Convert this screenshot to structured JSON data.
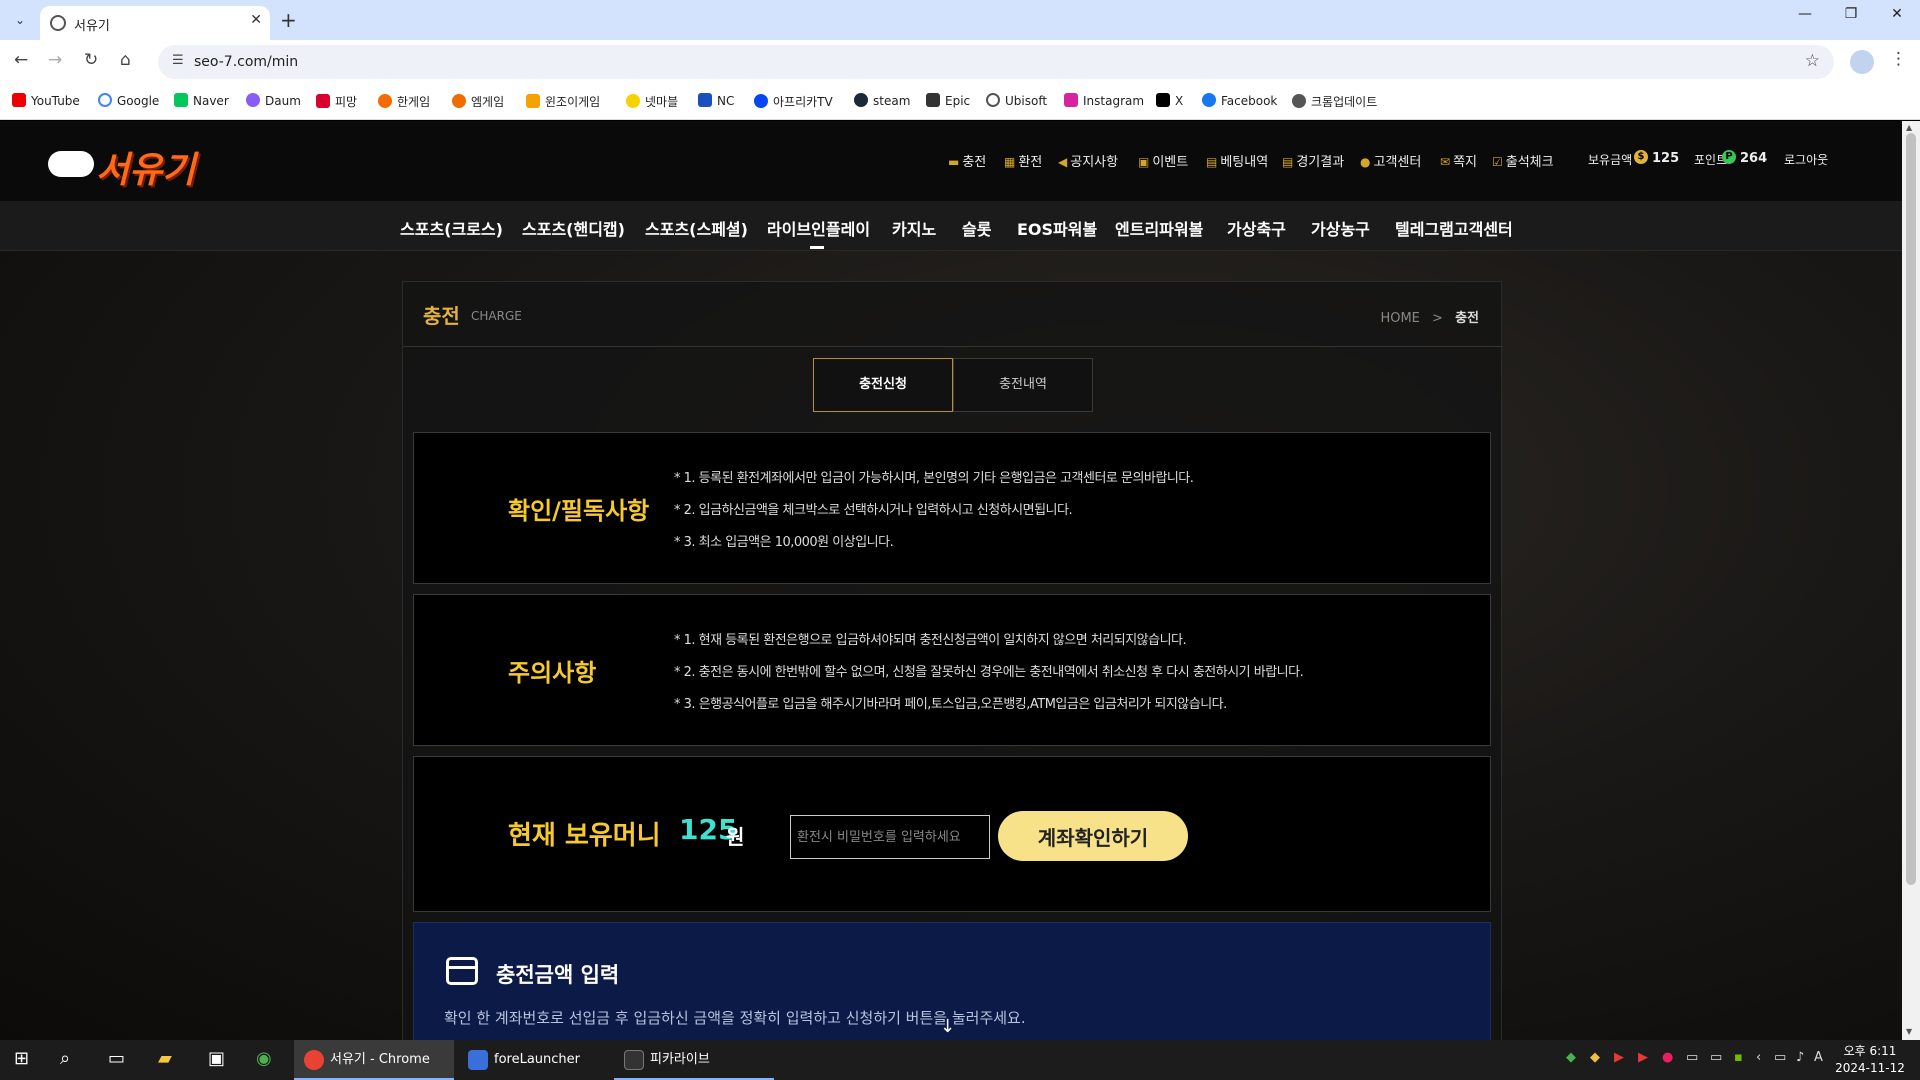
{
  "browser": {
    "tab_title": "서유기",
    "url": "seo-7.com/min",
    "bookmarks": [
      "YouTube",
      "Google",
      "Naver",
      "Daum",
      "피망",
      "한게임",
      "엠게임",
      "윈조이게임",
      "넷마블",
      "NC",
      "아프리카TV",
      "steam",
      "Epic",
      "Ubisoft",
      "Instagram",
      "X",
      "Facebook",
      "크롬업데이트"
    ]
  },
  "site": {
    "logo_text": "서유기",
    "top_menu": [
      "충전",
      "환전",
      "공지사항",
      "이벤트",
      "베팅내역",
      "경기결과",
      "고객센터",
      "쪽지",
      "출석체크"
    ],
    "balance_label": "보유금액",
    "balance_value": "125",
    "point_label": "포인트",
    "point_value": "264",
    "logout": "로그아웃",
    "gnb": [
      "스포츠(크로스)",
      "스포츠(핸디캡)",
      "스포츠(스페셜)",
      "라이브인플레이",
      "카지노",
      "슬롯",
      "EOS파워볼",
      "엔트리파워볼",
      "가상축구",
      "가상농구",
      "텔레그램고객센터"
    ]
  },
  "page": {
    "title": "충전",
    "subtitle": "CHARGE",
    "breadcrumb_home": "HOME",
    "breadcrumb_sep": ">",
    "breadcrumb_current": "충전",
    "tabs": [
      "충전신청",
      "충전내역"
    ],
    "confirm": {
      "heading": "확인/필독사항",
      "notes": [
        "*  1. 등록된 환전계좌에서만 입금이 가능하시며, 본인명의 기타 은행입금은 고객센터로 문의바랍니다.",
        "*  2. 입금하신금액을 체크박스로 선택하시거나 입력하시고 신청하시면됩니다.",
        "*  3. 최소 입금액은 10,000원 이상입니다."
      ]
    },
    "caution": {
      "heading": "주의사항",
      "notes": [
        "*  1. 현재 등록된 환전은행으로 입금하셔야되며 충전신청금액이 일치하지 않으면 처리되지않습니다.",
        "*  2. 충전은 동시에 한번밖에 할수 없으며, 신청을 잘못하신 경우에는 충전내역에서 취소신청 후 다시 충전하시기 바랍니다.",
        "*  3. 은행공식어플로 입금을 해주시기바라며 페이,토스입금,오픈뱅킹,ATM입금은 입금처리가 되지않습니다."
      ]
    },
    "money": {
      "label": "현재 보유머니",
      "value": "125",
      "unit": "원",
      "password_placeholder": "환전시 비밀번호를 입력하세요",
      "check_button": "계좌확인하기"
    },
    "amount": {
      "title": "충전금액 입력",
      "desc": "확인 한 계좌번호로 선입금 후 입금하신 금액을 정확히 입력하고 신청하기 버튼을 눌러주세요."
    }
  },
  "taskbar": {
    "apps": [
      "서유기 - Chrome",
      "foreLauncher",
      "피카라이브"
    ],
    "time": "오후 6:11",
    "date": "2024-11-12"
  }
}
